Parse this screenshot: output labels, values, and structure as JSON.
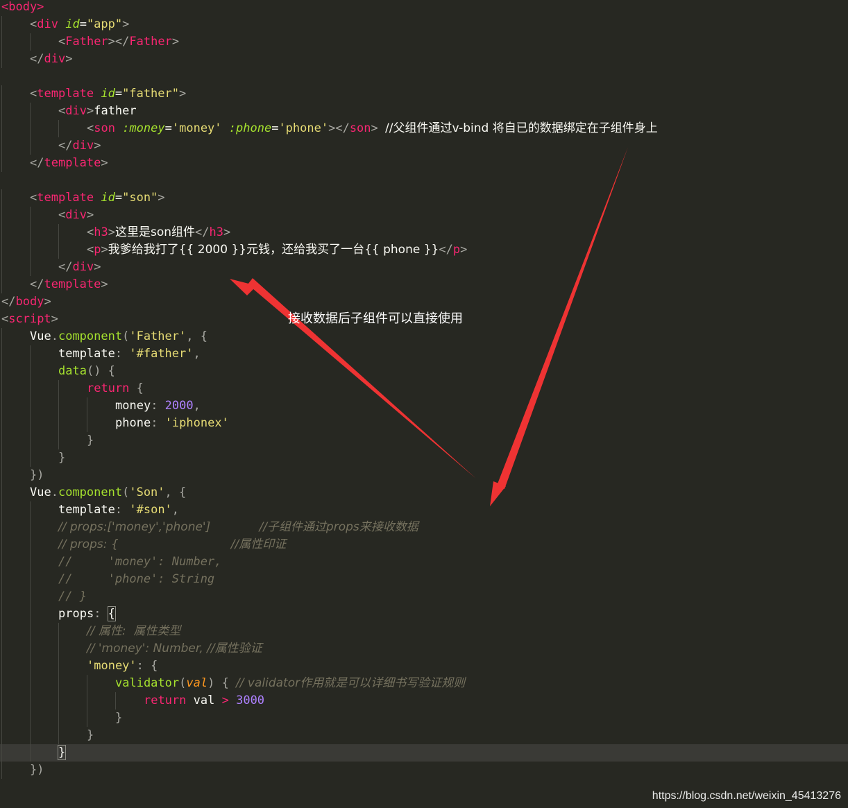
{
  "code_lines": [
    {
      "tokens": [
        [
          "tag",
          "<body>"
        ]
      ]
    },
    {
      "tokens": [
        [
          "punc",
          "<"
        ],
        [
          "tag",
          "div "
        ],
        [
          "attr",
          "id"
        ],
        [
          "plain",
          "="
        ],
        [
          "str",
          "\"app\""
        ],
        [
          "punc",
          ">"
        ]
      ]
    },
    {
      "tokens": [
        [
          "punc",
          "<"
        ],
        [
          "tag",
          "Father"
        ],
        [
          "punc",
          "></"
        ],
        [
          "tag",
          "Father"
        ],
        [
          "punc",
          ">"
        ]
      ]
    },
    {
      "tokens": [
        [
          "punc",
          "</"
        ],
        [
          "tag",
          "div"
        ],
        [
          "punc",
          ">"
        ]
      ]
    },
    {
      "tokens": []
    },
    {
      "tokens": [
        [
          "punc",
          "<"
        ],
        [
          "tag",
          "template "
        ],
        [
          "attr",
          "id"
        ],
        [
          "plain",
          "="
        ],
        [
          "str",
          "\"father\""
        ],
        [
          "punc",
          ">"
        ]
      ]
    },
    {
      "tokens": [
        [
          "punc",
          "<"
        ],
        [
          "tag",
          "div"
        ],
        [
          "punc",
          ">"
        ],
        [
          "plain",
          "father"
        ]
      ]
    },
    {
      "tokens": [
        [
          "punc",
          "<"
        ],
        [
          "tag",
          "son "
        ],
        [
          "attr",
          ":money"
        ],
        [
          "plain",
          "="
        ],
        [
          "str",
          "'money' "
        ],
        [
          "attr",
          ":phone"
        ],
        [
          "plain",
          "="
        ],
        [
          "str",
          "'phone'"
        ],
        [
          "punc",
          "></"
        ],
        [
          "tag",
          "son"
        ],
        [
          "punc",
          "> "
        ],
        [
          "plain",
          "//父组件通过v-bind 将自已的数据绑定在子组件身上"
        ]
      ]
    },
    {
      "tokens": [
        [
          "punc",
          "</"
        ],
        [
          "tag",
          "div"
        ],
        [
          "punc",
          ">"
        ]
      ]
    },
    {
      "tokens": [
        [
          "punc",
          "</"
        ],
        [
          "tag",
          "template"
        ],
        [
          "punc",
          ">"
        ]
      ]
    },
    {
      "tokens": []
    },
    {
      "tokens": [
        [
          "punc",
          "<"
        ],
        [
          "tag",
          "template "
        ],
        [
          "attr",
          "id"
        ],
        [
          "plain",
          "="
        ],
        [
          "str",
          "\"son\""
        ],
        [
          "punc",
          ">"
        ]
      ]
    },
    {
      "tokens": [
        [
          "punc",
          "<"
        ],
        [
          "tag",
          "div"
        ],
        [
          "punc",
          ">"
        ]
      ]
    },
    {
      "tokens": [
        [
          "punc",
          "<"
        ],
        [
          "tag",
          "h3"
        ],
        [
          "punc",
          ">"
        ],
        [
          "plain",
          "这里是son组件"
        ],
        [
          "punc",
          "</"
        ],
        [
          "tag",
          "h3"
        ],
        [
          "punc",
          ">"
        ]
      ]
    },
    {
      "tokens": [
        [
          "punc",
          "<"
        ],
        [
          "tag",
          "p"
        ],
        [
          "punc",
          ">"
        ],
        [
          "plain",
          "我爹给我打了{{ 2000 }}元钱，还给我买了一台{{ phone }}"
        ],
        [
          "punc",
          "</"
        ],
        [
          "tag",
          "p"
        ],
        [
          "punc",
          ">"
        ]
      ]
    },
    {
      "tokens": [
        [
          "punc",
          "</"
        ],
        [
          "tag",
          "div"
        ],
        [
          "punc",
          ">"
        ]
      ]
    },
    {
      "tokens": [
        [
          "punc",
          "</"
        ],
        [
          "tag",
          "template"
        ],
        [
          "punc",
          ">"
        ]
      ]
    },
    {
      "tokens": [
        [
          "punc",
          "</"
        ],
        [
          "tag",
          "body"
        ],
        [
          "punc",
          ">"
        ]
      ]
    },
    {
      "tokens": [
        [
          "punc",
          "<"
        ],
        [
          "tag",
          "script"
        ],
        [
          "punc",
          ">"
        ]
      ]
    },
    {
      "tokens": [
        [
          "plain",
          "Vue"
        ],
        [
          "punc",
          "."
        ],
        [
          "fn",
          "component"
        ],
        [
          "punc",
          "("
        ],
        [
          "str",
          "'Father'"
        ],
        [
          "punc",
          ", {"
        ]
      ]
    },
    {
      "tokens": [
        [
          "plain",
          "template"
        ],
        [
          "punc",
          ": "
        ],
        [
          "str",
          "'#father'"
        ],
        [
          "punc",
          ","
        ]
      ]
    },
    {
      "tokens": [
        [
          "fn",
          "data"
        ],
        [
          "punc",
          "() {"
        ]
      ]
    },
    {
      "tokens": [
        [
          "kw",
          "return"
        ],
        [
          "punc",
          " {"
        ]
      ]
    },
    {
      "tokens": [
        [
          "plain",
          "money"
        ],
        [
          "punc",
          ": "
        ],
        [
          "num",
          "2000"
        ],
        [
          "punc",
          ","
        ]
      ]
    },
    {
      "tokens": [
        [
          "plain",
          "phone"
        ],
        [
          "punc",
          ": "
        ],
        [
          "str",
          "'iphonex'"
        ]
      ]
    },
    {
      "tokens": [
        [
          "punc",
          "}"
        ]
      ]
    },
    {
      "tokens": [
        [
          "punc",
          "}"
        ]
      ]
    },
    {
      "tokens": [
        [
          "punc",
          "})"
        ]
      ]
    },
    {
      "tokens": [
        [
          "plain",
          "Vue"
        ],
        [
          "punc",
          "."
        ],
        [
          "fn",
          "component"
        ],
        [
          "punc",
          "("
        ],
        [
          "str",
          "'Son'"
        ],
        [
          "punc",
          ", {"
        ]
      ]
    },
    {
      "tokens": [
        [
          "plain",
          "template"
        ],
        [
          "punc",
          ": "
        ],
        [
          "str",
          "'#son'"
        ],
        [
          "punc",
          ","
        ]
      ]
    },
    {
      "tokens": [
        [
          "cmt",
          "// props:['money','phone']             //子组件通过props来接收数据"
        ]
      ]
    },
    {
      "tokens": [
        [
          "cmt",
          "// props: {                              //属性印证"
        ]
      ]
    },
    {
      "tokens": [
        [
          "cmt",
          "//     'money': Number,"
        ]
      ]
    },
    {
      "tokens": [
        [
          "cmt",
          "//     'phone': String"
        ]
      ]
    },
    {
      "tokens": [
        [
          "cmt",
          "// }"
        ]
      ]
    },
    {
      "tokens": [
        [
          "plain",
          "props"
        ],
        [
          "punc",
          ": "
        ],
        [
          "brkt",
          "{"
        ]
      ]
    },
    {
      "tokens": [
        [
          "cmt",
          "// 属性:  属性类型"
        ]
      ]
    },
    {
      "tokens": [
        [
          "cmt",
          "// 'money': Number, //属性验证"
        ]
      ]
    },
    {
      "tokens": [
        [
          "str",
          "'money'"
        ],
        [
          "punc",
          ": {"
        ]
      ]
    },
    {
      "tokens": [
        [
          "fn",
          "validator"
        ],
        [
          "punc",
          "("
        ],
        [
          "param",
          "val"
        ],
        [
          "punc",
          ") { "
        ],
        [
          "cmt",
          "// validator作用就是可以详细书写验证规则"
        ]
      ]
    },
    {
      "tokens": [
        [
          "kw",
          "return "
        ],
        [
          "plain",
          "val "
        ],
        [
          "kw",
          "> "
        ],
        [
          "num",
          "3000"
        ]
      ]
    },
    {
      "tokens": [
        [
          "punc",
          "}"
        ]
      ]
    },
    {
      "tokens": [
        [
          "punc",
          "}"
        ]
      ]
    },
    {
      "tokens": [
        [
          "brkt",
          "}"
        ]
      ]
    },
    {
      "tokens": [
        [
          "punc",
          "})"
        ]
      ]
    }
  ],
  "annotation": "接收数据后子组件可以直接使用",
  "watermark": "https://blog.csdn.net/weixin_45413276",
  "colors": {
    "background": "#272822",
    "tag": "#f92672",
    "attribute": "#a6e22e",
    "string": "#e6db74",
    "number": "#ae81ff",
    "comment": "#75715e",
    "arrow": "#ee3333"
  }
}
